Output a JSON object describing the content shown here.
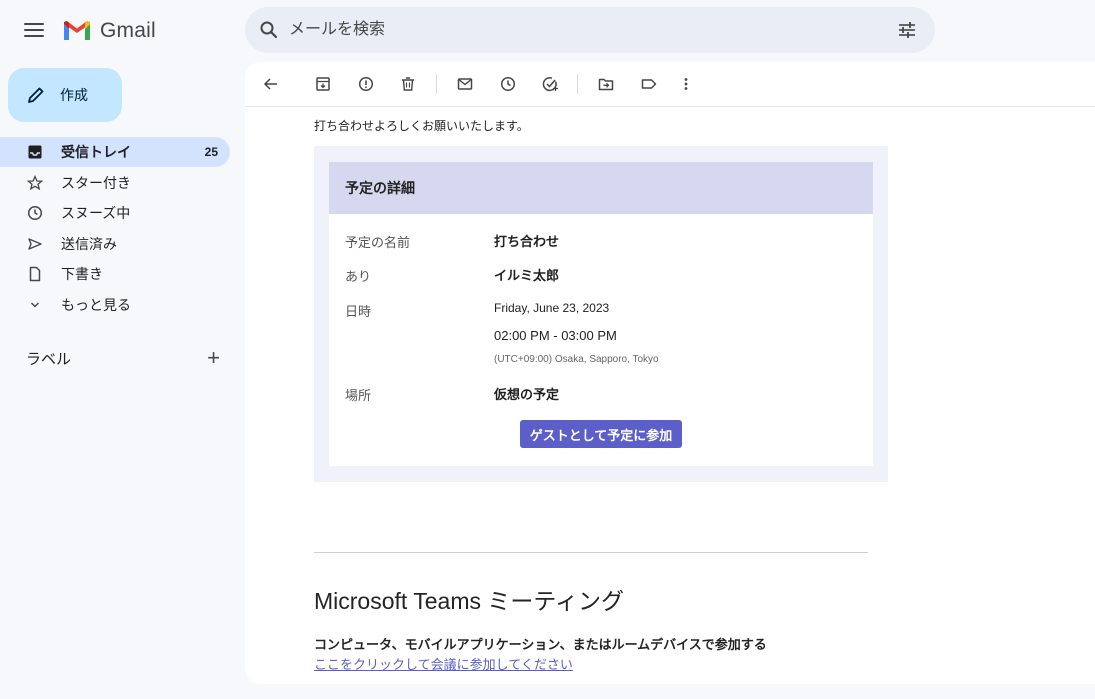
{
  "app": {
    "name": "Gmail"
  },
  "search": {
    "placeholder": "メールを検索"
  },
  "compose": {
    "label": "作成"
  },
  "nav": [
    {
      "key": "inbox",
      "label": "受信トレイ",
      "count": "25",
      "icon": "inbox-icon",
      "active": true
    },
    {
      "key": "starred",
      "label": "スター付き",
      "icon": "star-icon"
    },
    {
      "key": "snoozed",
      "label": "スヌーズ中",
      "icon": "clock-icon"
    },
    {
      "key": "sent",
      "label": "送信済み",
      "icon": "send-icon"
    },
    {
      "key": "drafts",
      "label": "下書き",
      "icon": "file-icon"
    },
    {
      "key": "more",
      "label": "もっと見る",
      "icon": "chevron-down-icon"
    }
  ],
  "labels": {
    "title": "ラベル"
  },
  "email": {
    "intro": "打ち合わせよろしくお願いいたします。",
    "card_title": "予定の詳細",
    "fields": {
      "name_label": "予定の名前",
      "name_value": "打ち合わせ",
      "organizer_label": "あり",
      "organizer_value": "イルミ太郎",
      "datetime_label": "日時",
      "date_value": "Friday, June 23, 2023",
      "time_value": "02:00 PM - 03:00 PM",
      "timezone_value": "(UTC+09:00) Osaka, Sapporo, Tokyo",
      "location_label": "場所",
      "location_value": "仮想の予定"
    },
    "join_button": "ゲストとして予定に参加",
    "teams_title": "Microsoft Teams ミーティング",
    "teams_sub": "コンピュータ、モバイルアプリケーション、またはルームデバイスで参加する",
    "teams_link": "ここをクリックして会議に参加してください"
  },
  "colors": {
    "accent": "#c2e7ff",
    "nav_active": "#d3e3fd",
    "teams_purple": "#5b5fc7"
  }
}
